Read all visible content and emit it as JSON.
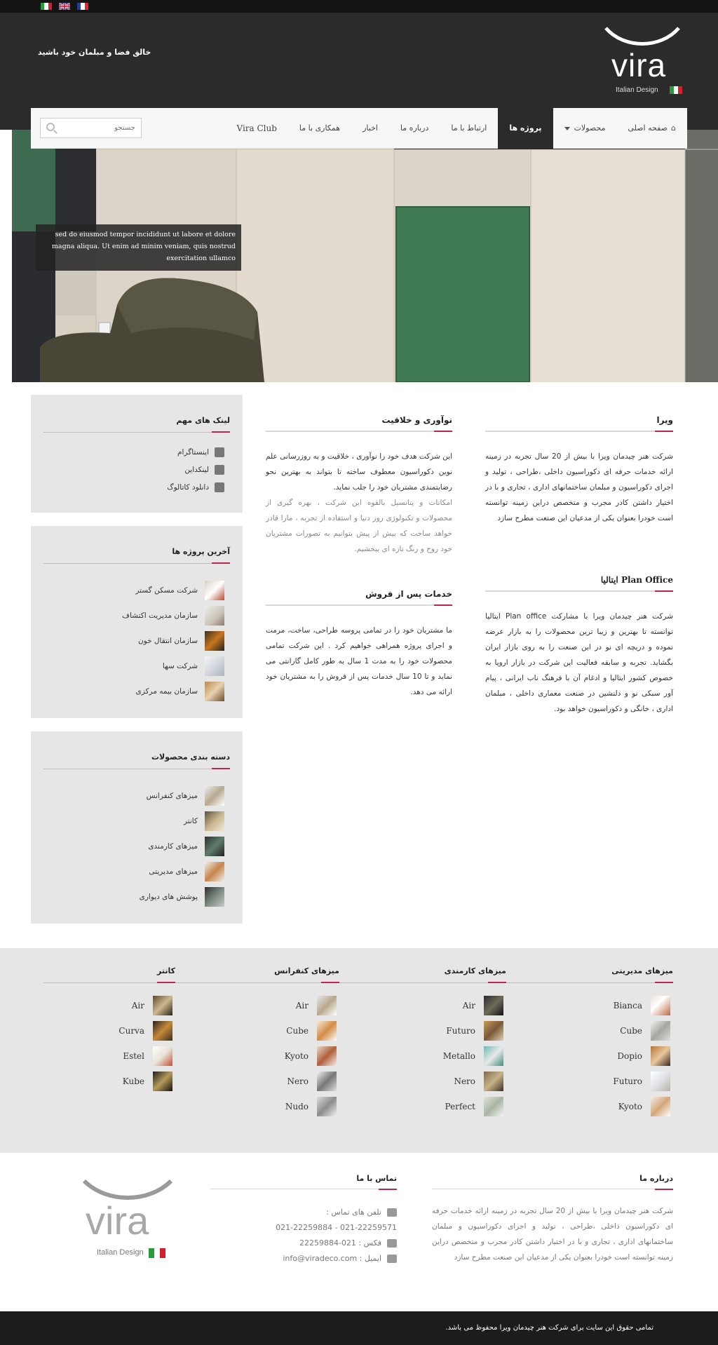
{
  "header": {
    "tagline": "خالق فضا و مبلمان خود باشید",
    "logo_word": "vira",
    "logo_sub": "Italian Design",
    "languages": [
      "it-flag-icon",
      "en-flag-icon",
      "fr-flag-icon"
    ]
  },
  "nav": {
    "items": [
      "صفحه اصلی",
      "محصولات",
      "پروژه ها",
      "ارتباط با ما",
      "درباره ما",
      "اخبار",
      "همکاری با ما",
      "Vira Club"
    ],
    "active": "پروژه ها",
    "search_placeholder": "جستجو"
  },
  "hero": {
    "caption": "sed do eiusmod tempor incididunt ut labore et dolore magna aliqua. Ut enim ad minim veniam, quis nostrud exercitation ullamco"
  },
  "vira": {
    "title": "ویرا",
    "text": "شرکت هنر چیدمان ویرا با بیش از 20 سال تجربه در زمینه ارائه خدمات حرفه ای دکوراسیون داخلی ،طراحی ، تولید و اجرای دکوراسیون و مبلمان ساختمانهای اداری ، تجاری و با در اختیار داشتن کادر مجرب و متخصص دراین زمینه توانسته است خودرا بعنوان یکی از مدعیان این صنعت مطرح سازد"
  },
  "plan_office": {
    "title": "Plan Office ایتالیا",
    "text": "شرکت هنر چیدمان ویرا با مشارکت Plan office ایتالیا توانسته تا بهترین و زیبا ترین محصولات را به بازار عرضه نموده و دریچه ای نو در این صنعت را به روی بازار ایران بگشاید. تجربه و سابقه فعالیت این شرکت در بازار اروپا به خصوص کشور ایتالیا و ادغام آن با فرهنگ ناب ایرانی ، پیام آور سبکی نو و دلنشین در صنعت معماری داخلی ، مبلمان اداری ، خانگی و دکوراسیون خواهد بود."
  },
  "innovation": {
    "title": "نوآوری و خلاقیت",
    "text1": "این شرکت هدف خود را نوآوری ، خلاقیت و به روزرسانی علم نوین دکوراسیون معطوف ساخته تا بتواند به بهترین نحو رضایتمندی مشتریان خود را جلب نماید.",
    "text2": "امکانات و پتانسیل بالقوه این شرکت ، بهره گیری از محصولات و تکنولوژی روز دنیا و استفاده از تجربه ، مارا قادر خواهد ساخت که بیش از پیش بتوانیم به تصورات مشتریان خود روح و رنگ تازه ای ببخشیم."
  },
  "after_sales": {
    "title": "خدمات پس از فروش",
    "text": "ما مشتریان خود را در تمامی پروسه طراحی، ساخت، مرمت و اجرای پروژه همراهی خواهیم کرد . این شرکت تمامی محصولات خود را به مدت 1 سال به طور کامل گارانتی می نماید و تا 10 سال خدمات پس از فروش را به مشتریان خود ارائه می دهد."
  },
  "important_links": {
    "title": "لینک های مهم",
    "items": [
      "اینستاگرام",
      "لینکداین",
      "دانلود کاتالوگ"
    ],
    "icons": [
      "instagram-icon",
      "linkedin-icon",
      "catalog-icon"
    ]
  },
  "latest_projects": {
    "title": "آخرین پروژه ها",
    "items": [
      "شرکت مسکن گستر",
      "سازمان مدیریت اکتشاف",
      "سازمان انتقال خون",
      "شرکت سها",
      "سازمان بیمه مرکزی"
    ]
  },
  "categories": {
    "title": "دسته بندی محصولات",
    "items": [
      "میزهای کنفرانس",
      "کانتر",
      "میزهای کارمندی",
      "میزهای مدیریتی",
      "پوشش های دیواری"
    ]
  },
  "product_columns": [
    {
      "title": "میزهای مدیریتی",
      "items": [
        "Bianca",
        "Cube",
        "Dopio",
        "Futuro",
        "Kyoto"
      ]
    },
    {
      "title": "میزهای کارمندی",
      "items": [
        "Air",
        "Futuro",
        "Metallo",
        "Nero",
        "Perfect"
      ]
    },
    {
      "title": "میزهای کنفرانس",
      "items": [
        "Air",
        "Cube",
        "Kyoto",
        "Nero",
        "Nudo"
      ]
    },
    {
      "title": "کانتر",
      "items": [
        "Air",
        "Curva",
        "Estel",
        "Kube"
      ]
    }
  ],
  "footer": {
    "about_title": "درباره ما",
    "about_text": "شرکت هنر چیدمان ویرا با بیش از 20 سال تجربه در زمینه ارائه خدمات حرفه ای دکوراسیون داخلی ،طراحی ، تولید و اجرای دکوراسیون و مبلمان ساختمانهای اداری ، تجاری و با در اختیار داشتن کادر مجرب و متخصص دراین زمینه توانسته است خودرا بعنوان یکی از مدعیان این صنعت مطرح سازد",
    "contact_title": "تماس با ما",
    "phone_label": "تلفن های تماس :",
    "phone_numbers": "021-22259884 - 021-22259571",
    "fax": "فکس : 021-22259884",
    "email": "ایمیل : info@viradeco.com",
    "copyright": "تمامی حقوق این سایت برای شرکت هنر چیدمان ویرا محفوظ می باشد."
  },
  "colors": {
    "accent": "#c0264b",
    "dark": "#2b2b2b",
    "panel": "#e6e6e6"
  }
}
